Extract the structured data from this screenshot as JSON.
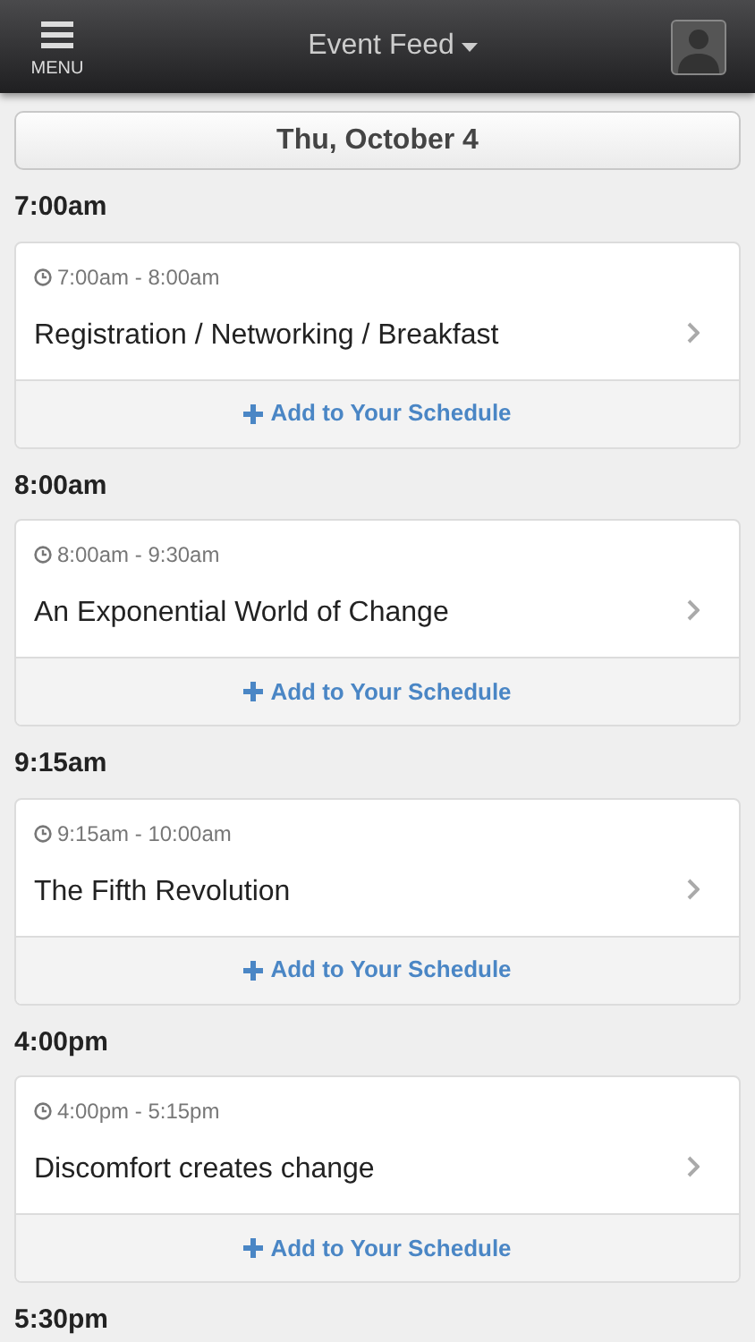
{
  "header": {
    "menu_label": "MENU",
    "title": "Event Feed"
  },
  "date": "Thu, October 4",
  "sections": [
    {
      "time": "7:00am",
      "event": {
        "range": "7:00am - 8:00am",
        "title": "Registration / Networking / Breakfast",
        "action": "Add to Your Schedule"
      }
    },
    {
      "time": "8:00am",
      "event": {
        "range": "8:00am - 9:30am",
        "title": "An Exponential World of Change",
        "action": "Add to Your Schedule"
      }
    },
    {
      "time": "9:15am",
      "event": {
        "range": "9:15am - 10:00am",
        "title": "The Fifth Revolution",
        "action": "Add to Your Schedule"
      }
    },
    {
      "time": "4:00pm",
      "event": {
        "range": "4:00pm - 5:15pm",
        "title": "Discomfort creates change",
        "action": "Add to Your Schedule"
      }
    },
    {
      "time": "5:30pm"
    }
  ]
}
